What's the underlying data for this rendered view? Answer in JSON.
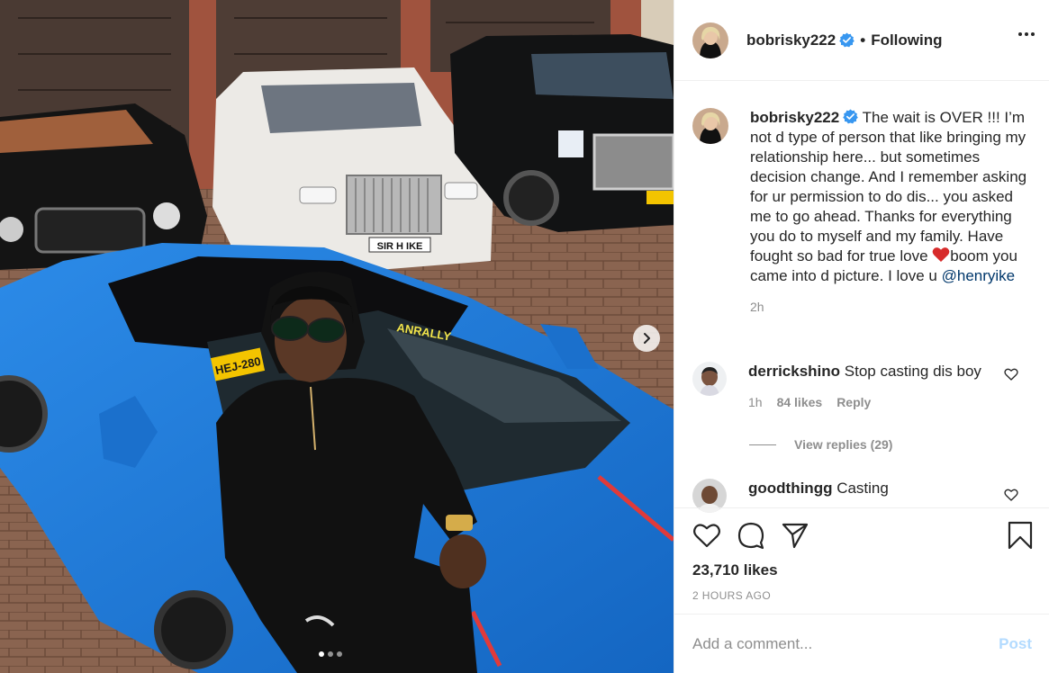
{
  "header": {
    "username": "bobrisky222",
    "separator": "•",
    "follow_status": "Following",
    "more_icon": "more-horizontal-icon"
  },
  "photo": {
    "plate_back": "SIR H IKE",
    "plate_front": "HEJ-280",
    "windshield_text": "ANRALLY",
    "dots_total": 3,
    "dots_active_index": 0
  },
  "caption": {
    "username": "bobrisky222",
    "text_part1": "The wait is OVER !!! I’m not d type of person that like bringing my relationship here... but sometimes decision change. And I remember asking for ur permission to do dis... you asked me to go ahead. Thanks for everything you do to myself and my family. Have fought so bad for true love ",
    "emoji": "red-heart-emoji",
    "text_part2": "boom you came into d picture. I love u ",
    "mention": "@henryike",
    "time": "2h"
  },
  "comments": [
    {
      "username": "derrickshino",
      "text": "Stop casting dis boy",
      "time": "1h",
      "likes": "84 likes",
      "reply": "Reply",
      "view_replies": "View replies (29)"
    },
    {
      "username": "goodthingg",
      "text": "Casting"
    }
  ],
  "actions": {
    "likes": "23,710 likes",
    "posted": "2 HOURS AGO"
  },
  "add_comment": {
    "placeholder": "Add a comment...",
    "post_label": "Post"
  },
  "colors": {
    "verified": "#3897f0",
    "link": "#00376b",
    "post_disabled": "#b3dbff",
    "muted": "#8e8e8e",
    "car_blue": "#1e7ad6"
  }
}
